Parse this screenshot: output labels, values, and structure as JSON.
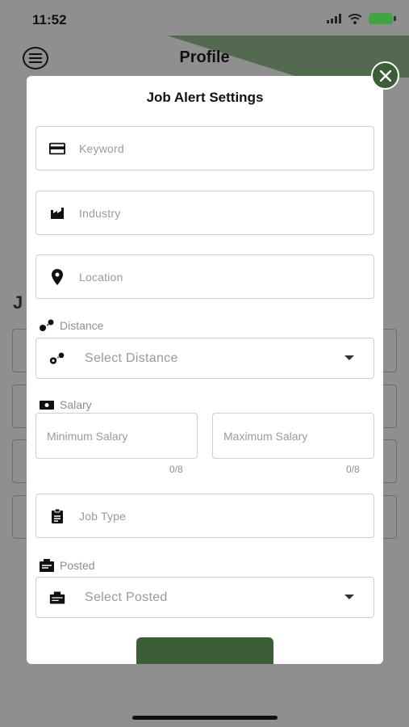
{
  "status_bar": {
    "time": "11:52"
  },
  "background": {
    "title": "Profile",
    "partial_letter": "J"
  },
  "modal": {
    "title": "Job Alert Settings",
    "keyword_placeholder": "Keyword",
    "industry_placeholder": "Industry",
    "location_placeholder": "Location",
    "distance_label": "Distance",
    "distance_select": "Select Distance",
    "salary_label": "Salary",
    "min_salary_placeholder": "Minimum Salary",
    "max_salary_placeholder": "Maximum Salary",
    "min_salary_counter": "0/8",
    "max_salary_counter": "0/8",
    "job_type_placeholder": "Job Type",
    "posted_label": "Posted",
    "posted_select": "Select Posted"
  },
  "colors": {
    "accent": "#3b5e36",
    "battery": "#3da642"
  }
}
